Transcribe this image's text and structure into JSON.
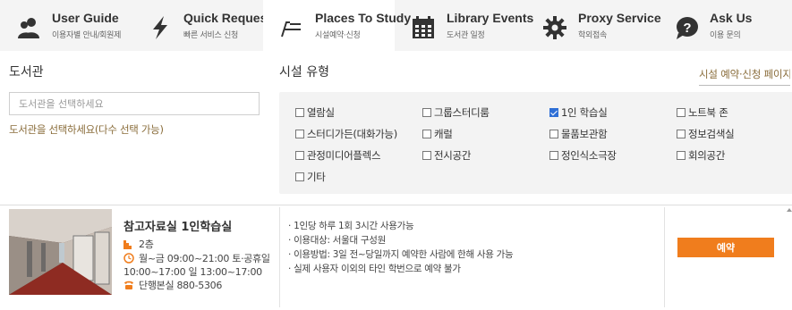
{
  "nav": {
    "items": [
      {
        "title": "User Guide",
        "sub": "이용자별 안내/회원제"
      },
      {
        "title": "Quick Requests",
        "sub": "빠른 서비스 신청"
      },
      {
        "title": "Places To Study",
        "sub": "시설예약·신청"
      },
      {
        "title": "Library Events",
        "sub": "도서관 일정"
      },
      {
        "title": "Proxy Service",
        "sub": "학외접속"
      },
      {
        "title": "Ask Us",
        "sub": "이용 문의"
      }
    ],
    "active_index": 2
  },
  "library": {
    "label": "도서관",
    "placeholder": "도서관을 선택하세요",
    "hint": "도서관을 선택하세요(다수 선택 가능)"
  },
  "facility": {
    "label": "시설 유형",
    "reserve_link": "시설 예약·신청 페이지",
    "options": [
      {
        "label": "열람실",
        "checked": false
      },
      {
        "label": "그룹스터디룸",
        "checked": false
      },
      {
        "label": "1인 학습실",
        "checked": true
      },
      {
        "label": "노트북 존",
        "checked": false
      },
      {
        "label": "스터디가든(대화가능)",
        "checked": false
      },
      {
        "label": "캐럴",
        "checked": false
      },
      {
        "label": "물품보관함",
        "checked": false
      },
      {
        "label": "정보검색실",
        "checked": false
      },
      {
        "label": "관정미디어플렉스",
        "checked": false
      },
      {
        "label": "전시공간",
        "checked": false
      },
      {
        "label": "정인식소극장",
        "checked": false
      },
      {
        "label": "회의공간",
        "checked": false
      },
      {
        "label": "기타",
        "checked": false
      }
    ]
  },
  "result": {
    "title": "참고자료실 1인학습실",
    "floor": "2층",
    "hours_line1": "월~금 09:00~21:00 토·공휴일",
    "hours_line2": "10:00~17:00 일 13:00~17:00",
    "phone": "단행본실 880-5306",
    "rules": [
      "· 1인당 하루 1회 3시간 사용가능",
      "· 이용대상: 서울대 구성원",
      "· 이용방법: 3일 전~당일까지 예약한 사람에 한해 사용 가능",
      "· 실제 사용자 이외의 타인 학번으로 예약 불가"
    ],
    "reserve_button": "예약"
  },
  "colors": {
    "accent_orange": "#f07d1d",
    "link_brown": "#8a6d3b",
    "check_blue": "#2f6fd6"
  }
}
